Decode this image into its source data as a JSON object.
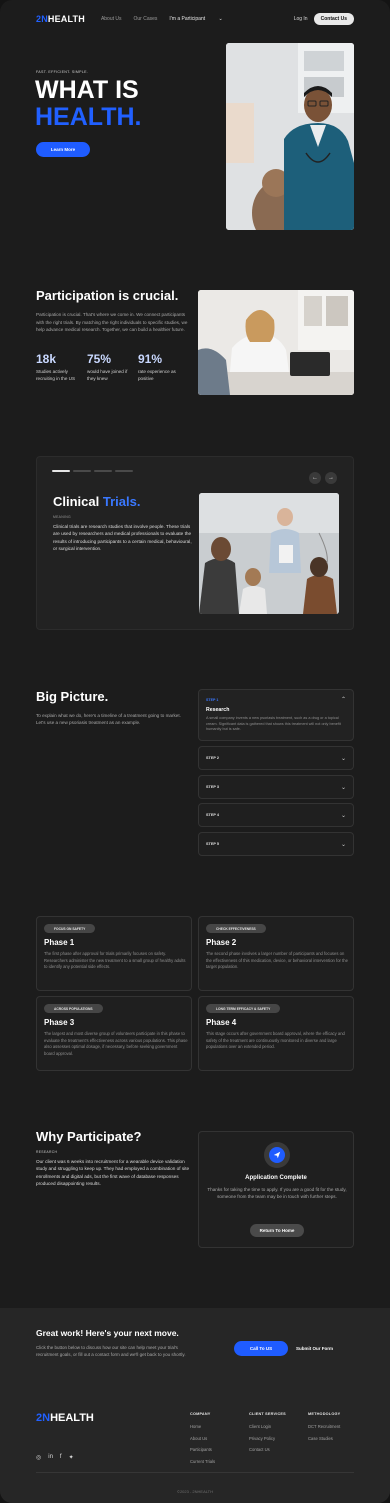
{
  "nav": {
    "logo_prefix": "2N",
    "logo_suffix": "HEALTH",
    "links": [
      "About Us",
      "Our Cases",
      "I'm a Participant"
    ],
    "login": "Log In",
    "contact": "Contact Us"
  },
  "hero": {
    "tagline": "FAST. EFFICIENT. SIMPLE.",
    "title_line1": "WHAT IS",
    "title_line2": "HEALTH.",
    "cta": "Learn More"
  },
  "participation": {
    "title": "Participation is crucial.",
    "body": "Participation is crucial. That's where we come in. We connect participants with the right trials. By matching the right individuals to specific studies, we help advance medical research. Together, we can build a healthier future.",
    "stats": [
      {
        "value": "18k",
        "label": "Studies actively recruiting in the US"
      },
      {
        "value": "75%",
        "label": "would have joined if they knew"
      },
      {
        "value": "91%",
        "label": "rate experience as positive"
      }
    ]
  },
  "clinical": {
    "title_a": "Clinical",
    "title_b": "Trials.",
    "meaning_label": "MEANING",
    "body": "Clinical trials are research studies that involve people. These trials are used by researchers and medical professionals to evaluate the results of introducing participants to a certain medical, behavioural, or surgical intervention.",
    "slider_position": 1,
    "slider_total": 4
  },
  "big_picture": {
    "title": "Big Picture.",
    "body": "To explain what we do, here's a timeline of a treatment going to market. Let's use a new psoriasis treatment as an example.",
    "open_step": {
      "label": "STEP 1",
      "title": "Research",
      "body": "A small company invents a new psoriasis treatment, such as a drug or a topical cream. Significant data is gathered that shows this treatment will not only benefit humanity but is safe."
    },
    "steps": [
      "STEP 2",
      "STEP 3",
      "STEP 4",
      "STEP 5"
    ]
  },
  "phases": [
    {
      "badge": "FOCUS ON SAFETY",
      "title": "Phase 1",
      "body": "The first phase after approval for trials primarily focuses on safety. Researchers administer the new treatment to a small group of healthy adults to identify any potential side effects."
    },
    {
      "badge": "CHECK EFFECTIVENESS",
      "title": "Phase 2",
      "body": "The second phase involves a larger number of participants and focuses on the effectiveness of this medication, device, or behavioral intervention for the target population."
    },
    {
      "badge": "ACROSS POPULATIONS",
      "title": "Phase 3",
      "body": "The largest and most diverse group of volunteers participate in this phase to evaluate the treatment's effectiveness across various populations. This phase also assesses optimal dosage, if necessary, before seeking government board approval."
    },
    {
      "badge": "LONG TERM EFFICACY & SAFETY",
      "title": "Phase 4",
      "body": "This stage occurs after government board approval, where the efficacy and safety of the treatment are continuously monitored in diverse and large populations over an extended period."
    }
  ],
  "why": {
    "title": "Why Participate?",
    "label": "RESEARCH",
    "body": "Our client was 6 weeks into recruitment for a wearable device validation study and struggling to keep up. They had employed a combination of site enrollments and digital ads, but the first wave of database responses produced disappointing results.",
    "card_title": "Application Complete",
    "card_body": "Thanks for taking the time to apply. If you are a good fit for the study, someone from the team may be in touch with further steps.",
    "card_button": "Return To Home"
  },
  "cta": {
    "title": "Great work! Here's your next move.",
    "body": "Click the button below to discuss how our site can help meet your trial's recruitment goals, or fill out a contact form and we'll get back to you shortly.",
    "primary": "Call To US",
    "secondary": "Submit Our Form"
  },
  "footer": {
    "company_h": "COMPANY",
    "company": [
      "Home",
      "About Us",
      "Participants",
      "Current Trials"
    ],
    "clients_h": "CLIENT SERVICES",
    "clients": [
      "Client Login",
      "Privacy Policy",
      "Contact Us"
    ],
    "method_h": "METHODOLOGY",
    "method": [
      "DCT Recruitment",
      "Case Studies"
    ],
    "social": [
      "instagram-icon",
      "linkedin-icon",
      "facebook-icon",
      "twitter-icon"
    ],
    "copyright": "©2023 - 2NHEALTH"
  },
  "colors": {
    "accent": "#1f5cff",
    "background": "#1c1c1c",
    "card": "#1f1f1f"
  }
}
